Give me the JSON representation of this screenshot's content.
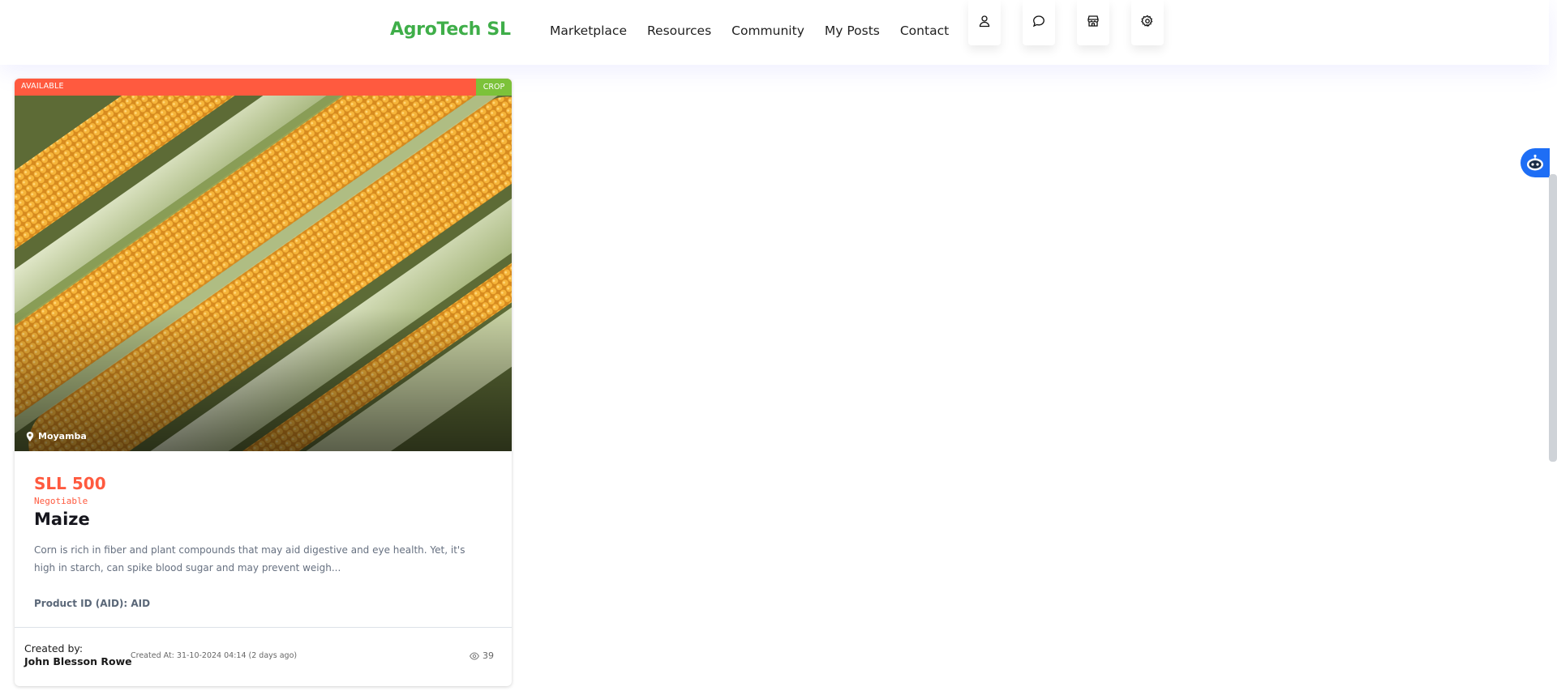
{
  "header": {
    "brand": "AgroTech SL",
    "nav": [
      "Marketplace",
      "Resources",
      "Community",
      "My Posts",
      "Contact"
    ],
    "icons": [
      "user-icon",
      "chat-icon",
      "store-icon",
      "settings-icon"
    ]
  },
  "listing": {
    "status_badge": "AVAILABLE",
    "category_badge": "CROP",
    "location": "Moyamba",
    "price": "SLL 500",
    "price_note": "Negotiable",
    "title": "Maize",
    "description": "Corn is rich in fiber and plant compounds that may aid digestive and eye health. Yet, it's high in starch, can spike blood sugar and may prevent weigh...",
    "product_id": "Product ID (AID): AID",
    "created_by_label": "Created by:",
    "created_by_name": "John Blesson Rowe",
    "created_at": "Created At: 31-10-2024 04:14 (2 days ago)",
    "views": "39"
  },
  "colors": {
    "brand": "#3fae49",
    "available": "#ff5a3f",
    "crop": "#7cc23a",
    "price": "#ff5a3f",
    "assistant": "#1e6ef5"
  },
  "assistant": {
    "icon": "robot-icon"
  }
}
